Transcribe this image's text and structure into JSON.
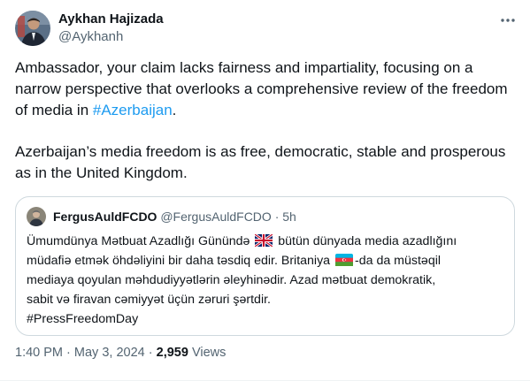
{
  "author": {
    "name": "Aykhan Hajizada",
    "handle": "@Aykhanh",
    "avatar_icon": "profile-photo"
  },
  "menu": {
    "icon": "more-horizontal-icon"
  },
  "tweet": {
    "p1_before": "Ambassador, your claim lacks fairness and impartiality, focusing on a narrow perspective that overlooks a comprehensive review of the freedom of media in ",
    "p1_hashtag": "#Azerbaijan",
    "p1_after": ".",
    "p2": "Azerbaijan’s media freedom is as free, democratic, stable and prosperous as in the United Kingdom."
  },
  "quote": {
    "name": "FergusAuldFCDO",
    "handle": "@FergusAuldFCDO",
    "separator": "·",
    "time": "5h",
    "line1_before": "Ümumdünya Mətbuat Azadlığı Günündə",
    "line1_after": "bütün dünyada media azadlığını",
    "line2_before": "müdafiə etmək öhdəliyini bir daha təsdiq edir. Britaniya",
    "line2_after": "-da da müstəqil",
    "line3": "mediaya qoyulan məhdudiyyətlərin əleyhinədir. Azad mətbuat demokratik,",
    "line4": "sabit və firavan cəmiyyət üçün zəruri şərtdir.",
    "hashtag": "#PressFreedomDay",
    "flags": [
      "uk-flag-icon",
      "azerbaijan-flag-icon"
    ]
  },
  "footer": {
    "time": "1:40 PM",
    "sep1": "·",
    "date": "May 3, 2024",
    "sep2": "·",
    "views_count": "2,959",
    "views_label": "Views"
  },
  "colors": {
    "text": "#0f1419",
    "secondary": "#536471",
    "link": "#1d9bf0",
    "border": "#cfd9de"
  }
}
